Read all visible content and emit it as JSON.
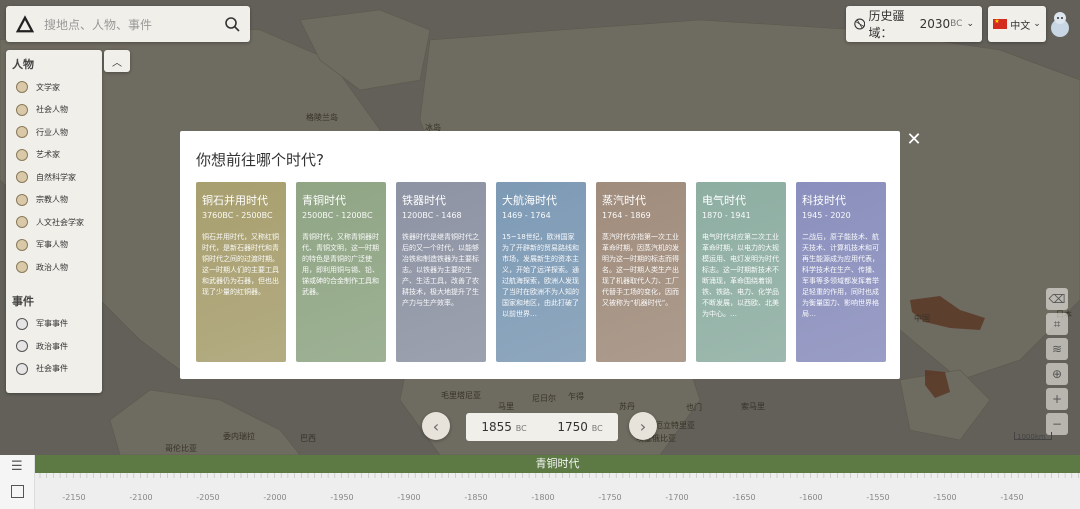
{
  "search": {
    "placeholder": "搜地点、人物、事件"
  },
  "territory": {
    "label": "历史疆域：",
    "year": "2030",
    "era": "BC"
  },
  "language": {
    "label": "中文"
  },
  "sidebar": {
    "people_header": "人物",
    "people": [
      "文学家",
      "社会人物",
      "行业人物",
      "艺术家",
      "自然科学家",
      "宗教人物",
      "人文社会学家",
      "军事人物",
      "政治人物"
    ],
    "events_header": "事件",
    "events": [
      "军事事件",
      "政治事件",
      "社会事件"
    ]
  },
  "map_labels": [
    "格陵兰岛",
    "冰岛",
    "日本",
    "中国",
    "毛里塔尼亚",
    "马里",
    "尼日尔",
    "乍得",
    "苏丹",
    "厄立特里亚",
    "也门",
    "索马里",
    "埃塞俄比亚",
    "委内瑞拉",
    "巴西",
    "哥伦比亚"
  ],
  "scale_label": "1000km",
  "year_nav": {
    "left_year": "1855",
    "right_year": "1750",
    "era": "BC"
  },
  "timeline": {
    "band_label": "青铜时代",
    "ticks": [
      "-2150",
      "-2100",
      "-2050",
      "-2000",
      "-1950",
      "-1900",
      "-1850",
      "-1800",
      "-1750",
      "-1700",
      "-1650",
      "-1600",
      "-1550",
      "-1500",
      "-1450"
    ]
  },
  "modal": {
    "title": "你想前往哪个时代?",
    "eras": [
      {
        "name": "铜石并用时代",
        "years": "3760BC - 2500BC",
        "desc": "铜石并用时代，又称红铜时代，是新石器时代和青铜时代之间的过渡时期。这一时期人们的主要工具和武器仍为石器，但也出现了少量的红铜器。",
        "color": "#a89f6f"
      },
      {
        "name": "青铜时代",
        "years": "2500BC - 1200BC",
        "desc": "青铜时代，又称青铜器时代、青铜文明，这一时期的特色是青铜的广泛使用，即利用铜与锡、铅、锑或砷的合金制作工具和武器。",
        "color": "#8fa584"
      },
      {
        "name": "铁器时代",
        "years": "1200BC - 1468",
        "desc": "铁器时代是继青铜时代之后的又一个时代，以能够冶铁和制造铁器为主要标志。以铁器为主要的生产、生活工具，改善了农耕技术，极大地提升了生产力与生产效率。",
        "color": "#8d93a3"
      },
      {
        "name": "大航海时代",
        "years": "1469 - 1764",
        "desc": "15~18世纪，欧洲国家为了开辟新的贸易路线和市场，发展新生的资本主义，开始了远洋探索。通过航海探索，欧洲人发现了当时在欧洲不为人知的国家和地区，由此打破了以前世界…",
        "color": "#7d9ab5"
      },
      {
        "name": "蒸汽时代",
        "years": "1764 - 1869",
        "desc": "蒸汽时代亦指第一次工业革命时期，因蒸汽机的发明为这一时期的标志而得名。这一时期人类生产出现了机器取代人力、工厂代替手工场的变化，因而又被称为“机器时代”。",
        "color": "#a08c7c"
      },
      {
        "name": "电气时代",
        "years": "1870 - 1941",
        "desc": "电气时代对应第二次工业革命时期，以电力的大规模运用、电灯发明为时代标志。这一时期新技术不断涌现，革命围绕着钢铁、铁路、电力、化学品不断发展，以西欧、北美为中心。…",
        "color": "#8eaea2"
      },
      {
        "name": "科技时代",
        "years": "1945 - 2020",
        "desc": "二战后，原子能技术、航天技术、计算机技术和可再生能源成为应用代表，科学技术在生产、传播、军事等多领域都发挥着举足轻重的作用，同时也成为衡量国力、影响世界格局…",
        "color": "#8a8fbd"
      }
    ]
  }
}
